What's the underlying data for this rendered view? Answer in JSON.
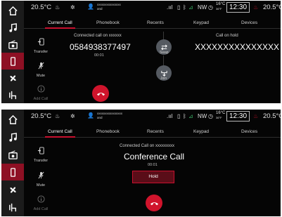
{
  "colors": {
    "accent": "#c8102e",
    "rail_active": "#8e1024",
    "background": "#050505"
  },
  "rail_icons": [
    "home-icon",
    "music-icon",
    "radio-icon",
    "phone-icon",
    "fan-icon",
    "seat-heat-icon"
  ],
  "screens": [
    {
      "status": {
        "temp_left": "20.5°C",
        "caller_name": "xxxxxxxxxxxxxxx",
        "caller_sub": "and",
        "compass": "NW",
        "outside_temp": "16°C",
        "outside_sub": "36°F",
        "clock": "12:30",
        "temp_right": "20.5°C"
      },
      "tabs": [
        "Current Call",
        "Phonebook",
        "Recents",
        "Keypad",
        "Devices"
      ],
      "active_tab": 0,
      "side_actions": {
        "transfer": "Transfer",
        "mute": "Mute",
        "add_call": "Add Call"
      },
      "call": {
        "connected_label": "Connected call on xxxxxx",
        "number": "0584938377497",
        "timer": "00:01",
        "swap_label": "Swap",
        "join_label": "Join",
        "hold_label": "Call on hold",
        "hold_number": "XXXXXXXXXXXXXXX"
      }
    },
    {
      "status": {
        "temp_left": "20.5°C",
        "caller_name": "xxxxxxxxxxxxxxxx",
        "caller_sub": "and",
        "compass": "NW",
        "outside_temp": "16°C",
        "outside_sub": "36°F",
        "clock": "12:30",
        "temp_right": "20.5°C"
      },
      "tabs": [
        "Current Call",
        "Phonebook",
        "Recents",
        "Keypad",
        "Devices"
      ],
      "active_tab": 0,
      "side_actions": {
        "transfer": "Transfer",
        "mute": "Mute",
        "add_call": "Add Call"
      },
      "call": {
        "connected_label": "Connected Call on xxxxxxxxx",
        "title": "Conference Call",
        "timer": "00:01",
        "hold_button": "Hold"
      }
    }
  ]
}
